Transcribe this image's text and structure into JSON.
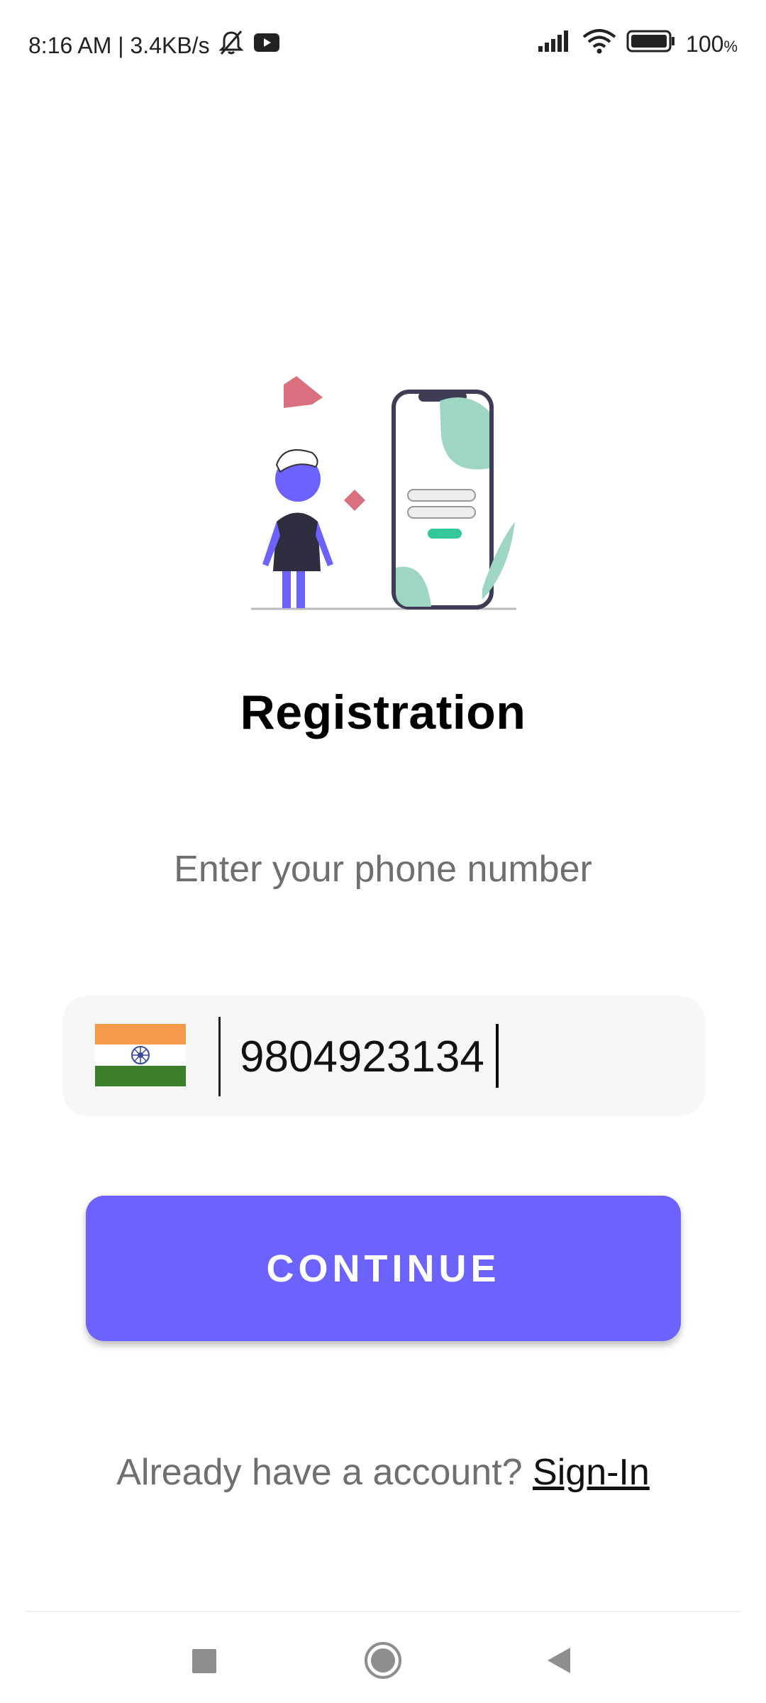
{
  "status_bar": {
    "time_speed": "8:16 AM | 3.4KB/s",
    "battery_percent": "100",
    "battery_sign": "%",
    "icons": [
      "mute-bell-icon",
      "youtube-icon",
      "signal-icon",
      "wifi-icon",
      "battery-icon"
    ]
  },
  "main": {
    "title": "Registration",
    "subtitle": "Enter your phone number",
    "country_flag": "india-flag-icon",
    "phone_value": "9804923134",
    "continue_label": "CONTINUE",
    "signin_prompt": "Already have a account? ",
    "signin_link": "Sign-In"
  },
  "colors": {
    "accent": "#6c63ff",
    "input_bg": "#f7f7f7",
    "muted_text": "#6f6f6f"
  },
  "nav_bar": {
    "buttons": [
      "recents-icon",
      "home-icon",
      "back-icon"
    ]
  }
}
